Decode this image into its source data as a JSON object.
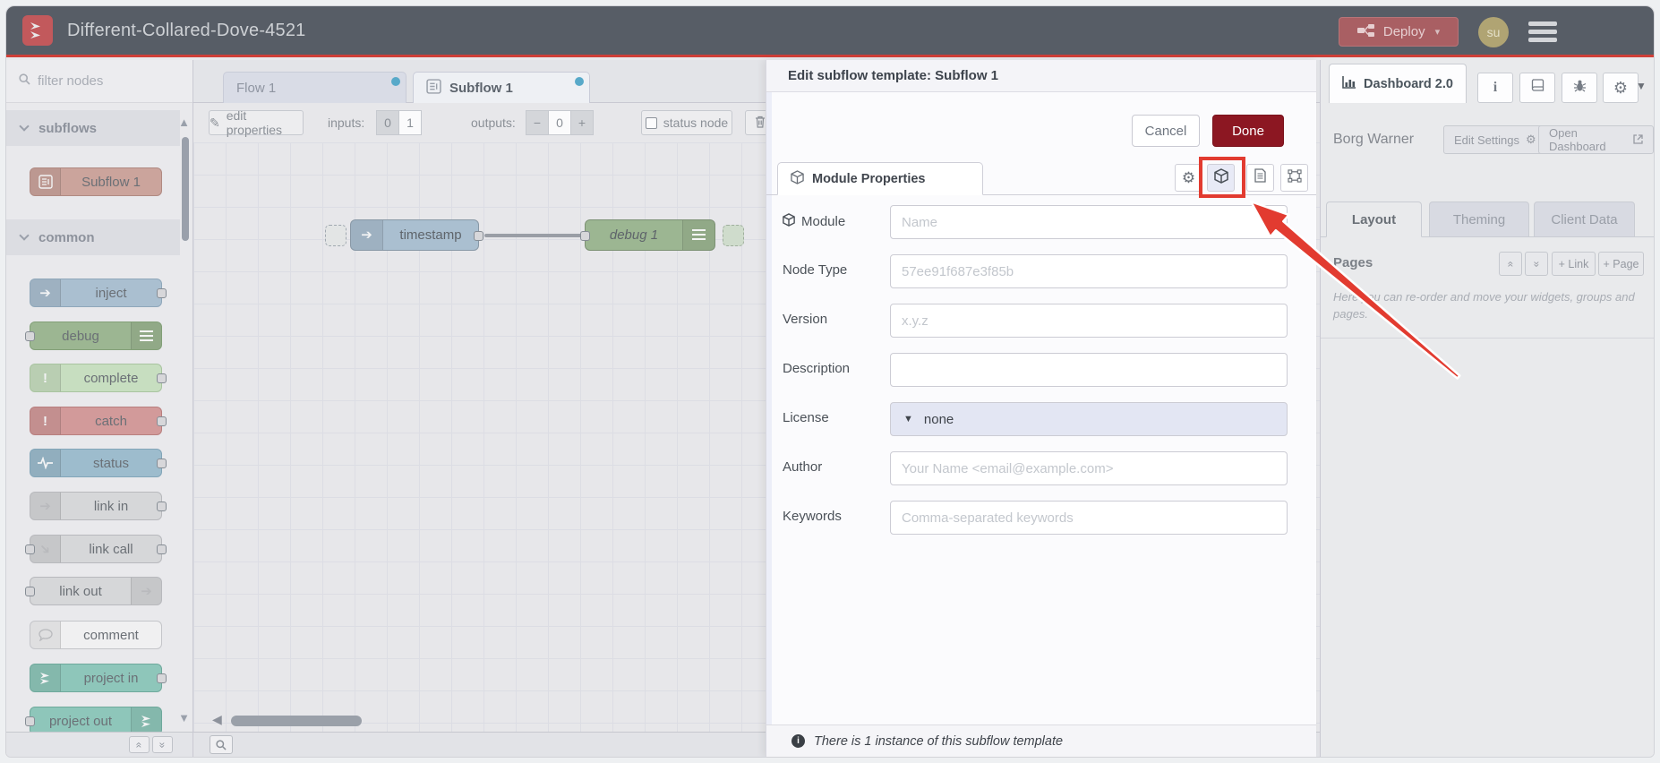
{
  "header": {
    "title": "Different-Collared-Dove-4521",
    "deploy_label": "Deploy",
    "avatar_initials": "su"
  },
  "palette": {
    "filter_placeholder": "filter nodes",
    "sections": [
      {
        "label": "subflows"
      },
      {
        "label": "common"
      }
    ],
    "subflow_items": [
      {
        "label": "Subflow 1"
      }
    ],
    "common_items": [
      {
        "label": "inject"
      },
      {
        "label": "debug"
      },
      {
        "label": "complete"
      },
      {
        "label": "catch"
      },
      {
        "label": "status"
      },
      {
        "label": "link in"
      },
      {
        "label": "link call"
      },
      {
        "label": "link out"
      },
      {
        "label": "comment"
      },
      {
        "label": "project in"
      },
      {
        "label": "project out"
      }
    ]
  },
  "workspace": {
    "tabs": [
      {
        "label": "Flow 1"
      },
      {
        "label": "Subflow 1"
      }
    ],
    "toolbar": {
      "edit_properties": "edit properties",
      "inputs_label": "inputs:",
      "inputs_options": [
        "0",
        "1"
      ],
      "outputs_label": "outputs:",
      "minus": "−",
      "outputs_value": "0",
      "plus": "+",
      "status_node": "status node"
    },
    "nodes": [
      {
        "label": "timestamp"
      },
      {
        "label": "debug 1"
      }
    ]
  },
  "dialog": {
    "title": "Edit subflow template: Subflow 1",
    "cancel": "Cancel",
    "done": "Done",
    "tab": "Module Properties",
    "fields": [
      {
        "label": "Module",
        "placeholder": "Name"
      },
      {
        "label": "Node Type",
        "placeholder": "57ee91f687e3f85b"
      },
      {
        "label": "Version",
        "placeholder": "x.y.z"
      },
      {
        "label": "Description",
        "placeholder": ""
      },
      {
        "label": "License",
        "value": "none"
      },
      {
        "label": "Author",
        "placeholder": "Your Name <email@example.com>"
      },
      {
        "label": "Keywords",
        "placeholder": "Comma-separated keywords"
      }
    ],
    "footer_note": "There is 1 instance of this subflow template"
  },
  "sidebar": {
    "tab": "Dashboard 2.0",
    "project": "Borg Warner",
    "edit_settings": "Edit Settings",
    "open_dashboard": "Open Dashboard",
    "tabs": [
      {
        "label": "Layout"
      },
      {
        "label": "Theming"
      },
      {
        "label": "Client Data"
      }
    ],
    "pages_title": "Pages",
    "link_button": "+ Link",
    "page_button": "+ Page",
    "help_text": "Here you can re-order and move your widgets, groups and pages."
  },
  "icons": {
    "logo": "node-red-logo",
    "deploy": "deploy-graph-icon",
    "menu": "hamburger-icon",
    "filter": "search-icon",
    "dialog_tabs": [
      "gear-icon",
      "cube-icon",
      "document-icon",
      "object-group-icon"
    ],
    "sidebar_buttons": [
      "info-icon",
      "book-icon",
      "bug-icon",
      "gear-icon"
    ],
    "annotation": "red-arrow"
  },
  "colors": {
    "header_accent": "#cf3f38",
    "done_button": "#8c1722",
    "annotation": "#e23b30",
    "tab_dot": "#58a9c9",
    "license_field": "#e3e6f3"
  }
}
